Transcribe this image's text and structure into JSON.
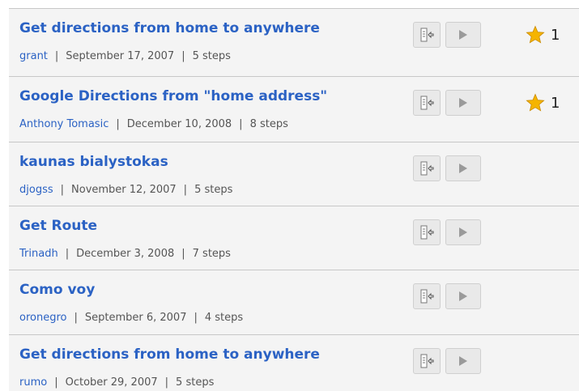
{
  "scripts": [
    {
      "title": "Get directions from home to anywhere",
      "author": "grant",
      "date": "September 17, 2007",
      "steps": "5 steps",
      "rating": "1"
    },
    {
      "title": "Google Directions from \"home address\"",
      "author": "Anthony Tomasic",
      "date": "December 10, 2008",
      "steps": "8 steps",
      "rating": "1"
    },
    {
      "title": "kaunas bialystokas",
      "author": "djogss",
      "date": "November 12, 2007",
      "steps": "5 steps",
      "rating": ""
    },
    {
      "title": "Get Route",
      "author": "Trinadh",
      "date": "December 3, 2008",
      "steps": "7 steps",
      "rating": ""
    },
    {
      "title": "Como voy",
      "author": "oronegro",
      "date": "September 6, 2007",
      "steps": "4 steps",
      "rating": ""
    },
    {
      "title": "Get directions from home to anywhere",
      "author": "rumo",
      "date": "October 29, 2007",
      "steps": "5 steps",
      "rating": ""
    }
  ],
  "separator": "|",
  "icons": {
    "open": "open-in-sidebar-icon",
    "run": "play-icon",
    "rating": "star-icon"
  },
  "colors": {
    "link": "#2b62c4",
    "meta_text": "#555555",
    "row_background": "#f4f4f4",
    "divider": "#c7c7c7",
    "button_background": "#e9e9e9",
    "play_icon": "#9a9a9a",
    "star": "#f5b400"
  }
}
